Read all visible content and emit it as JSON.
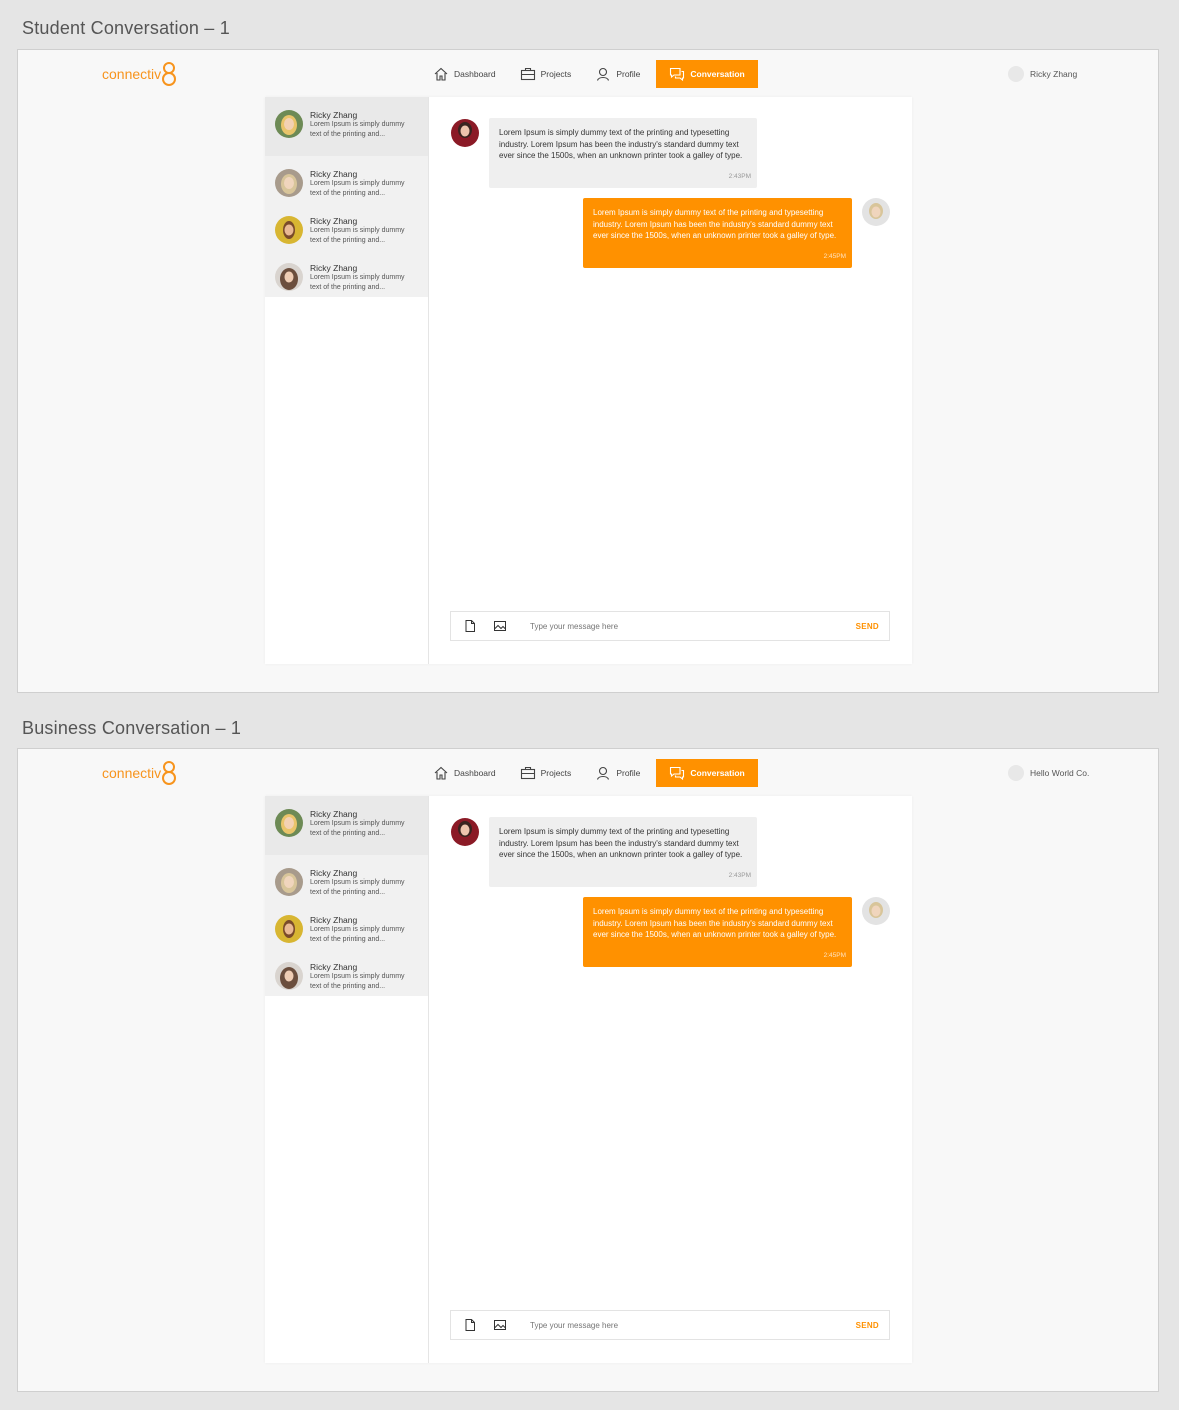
{
  "colors": {
    "accent": "#ff9100",
    "background": "#e5e5e5",
    "panel": "#ffffff"
  },
  "frames": [
    {
      "title": "Student Conversation – 1",
      "brand": "connectiv",
      "nav": [
        {
          "label": "Dashboard",
          "icon": "home-icon"
        },
        {
          "label": "Projects",
          "icon": "briefcase-icon"
        },
        {
          "label": "Profile",
          "icon": "user-icon"
        },
        {
          "label": "Conversation",
          "icon": "chat-icon",
          "active": true
        }
      ],
      "user_name": "Ricky Zhang",
      "contacts": [
        {
          "name": "Ricky Zhang",
          "preview": "Lorem Ipsum is simply dummy text of the printing and..."
        },
        {
          "name": "Ricky Zhang",
          "preview": "Lorem Ipsum is simply dummy text of the printing and..."
        },
        {
          "name": "Ricky Zhang",
          "preview": "Lorem Ipsum is simply dummy text of the printing and..."
        },
        {
          "name": "Ricky Zhang",
          "preview": "Lorem Ipsum is simply dummy text of the printing and..."
        }
      ],
      "messages": [
        {
          "text": "Lorem Ipsum is simply dummy text of the printing and typesetting industry. Lorem Ipsum has been the industry's standard dummy text ever since the 1500s, when an unknown printer took a galley of type.",
          "time": "2:43PM"
        },
        {
          "text": "Lorem Ipsum is simply dummy text of the printing and typesetting industry. Lorem Ipsum has been the industry's standard dummy text ever since the 1500s, when an unknown printer took a galley of type.",
          "time": "2:45PM"
        }
      ],
      "composer": {
        "placeholder": "Type your message here",
        "send_label": "SEND"
      }
    },
    {
      "title": "Business Conversation – 1",
      "brand": "connectiv",
      "nav": [
        {
          "label": "Dashboard",
          "icon": "home-icon"
        },
        {
          "label": "Projects",
          "icon": "briefcase-icon"
        },
        {
          "label": "Profile",
          "icon": "user-icon"
        },
        {
          "label": "Conversation",
          "icon": "chat-icon",
          "active": true
        }
      ],
      "user_name": "Hello World Co.",
      "contacts": [
        {
          "name": "Ricky Zhang",
          "preview": "Lorem Ipsum is simply dummy text of the printing and..."
        },
        {
          "name": "Ricky Zhang",
          "preview": "Lorem Ipsum is simply dummy text of the printing and..."
        },
        {
          "name": "Ricky Zhang",
          "preview": "Lorem Ipsum is simply dummy text of the printing and..."
        },
        {
          "name": "Ricky Zhang",
          "preview": "Lorem Ipsum is simply dummy text of the printing and..."
        }
      ],
      "messages": [
        {
          "text": "Lorem Ipsum is simply dummy text of the printing and typesetting industry. Lorem Ipsum has been the industry's standard dummy text ever since the 1500s, when an unknown printer took a galley of type.",
          "time": "2:43PM"
        },
        {
          "text": "Lorem Ipsum is simply dummy text of the printing and typesetting industry. Lorem Ipsum has been the industry's standard dummy text ever since the 1500s, when an unknown printer took a galley of type.",
          "time": "2:45PM"
        }
      ],
      "composer": {
        "placeholder": "Type your message here",
        "send_label": "SEND"
      }
    }
  ]
}
